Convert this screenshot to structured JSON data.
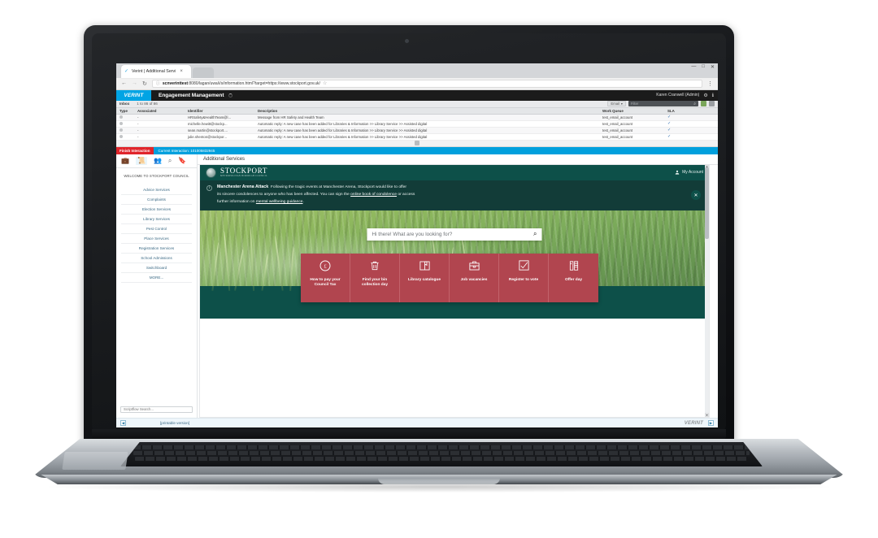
{
  "browser": {
    "tab_title": "Verint | Additional Servi",
    "tab_favicon": "verint-check-icon",
    "tab_close": "×",
    "window_minimize": "—",
    "window_maximize": "□",
    "window_close": "✕",
    "back_icon": "←",
    "forward_icon": "→",
    "reload_icon": "↻",
    "lock_icon": "ⓘ",
    "url_host": "scnverinttest",
    "url_rest": ":8080/lagan/uwa/i/s/information.html?target=https://www.stockport.gov.uk/",
    "star_icon": "☆",
    "menu_icon": "⋮"
  },
  "verint": {
    "logo": "VERINT",
    "app_title": "Engagement Management",
    "user": "Karen Cranwell (Admin)",
    "settings_icon": "⚙",
    "info_icon": "ℹ"
  },
  "inbox": {
    "label": "Inbox",
    "count": "1 to 86 of 86",
    "dropdown_value": "Email",
    "dropdown_caret": "▾",
    "filter_placeholder": "Filter",
    "search_icon": "⌕",
    "grid_icon": "grid-toggle-icon",
    "settings_icon": "gear-icon"
  },
  "grid": {
    "columns": [
      "Type",
      "Associated",
      "Identifier",
      "Description",
      "Work Queue",
      "SLA"
    ],
    "rows": [
      {
        "type": "●",
        "associated": "-",
        "identifier": "HRSafety&HealthTeam@l...",
        "description": "Message from HR Safety and Health Team",
        "work_queue": "test_email_account",
        "sla": "✓"
      },
      {
        "type": "●",
        "associated": "-",
        "identifier": "michelle.hewitt@stockp...",
        "description": "Automatic reply: A new case has been added for Libraries & Information >> Library Service >> Assisted digital",
        "work_queue": "test_email_account",
        "sla": "✓"
      },
      {
        "type": "●",
        "associated": "-",
        "identifier": "sean.martin@stockport....",
        "description": "Automatic reply: A new case has been added for Libraries & Information >> Library Service >> Assisted digital",
        "work_queue": "test_email_account",
        "sla": "✓"
      },
      {
        "type": "●",
        "associated": "-",
        "identifier": "julie.shenton@stockpor...",
        "description": "Automatic reply: A new case has been added for Libraries & Information >> Library Service >> Assisted digital",
        "work_queue": "test_email_account",
        "sla": "✓"
      }
    ]
  },
  "interaction": {
    "finish_label": "Finish Interaction",
    "current_label": "Current Interaction: 101005832945"
  },
  "toolbar": {
    "icons": [
      {
        "name": "briefcase-icon",
        "glyph": "💼",
        "selected": false
      },
      {
        "name": "document-icon",
        "glyph": "📜",
        "selected": true
      },
      {
        "name": "people-icon",
        "glyph": "👥",
        "selected": false
      },
      {
        "name": "search-icon",
        "glyph": "⌕",
        "selected": false
      },
      {
        "name": "bookmark-icon",
        "glyph": "🔖",
        "selected": false
      }
    ]
  },
  "sidebar": {
    "welcome": "WELCOME TO STOCKPORT COUNCIL",
    "items": [
      {
        "label": "Advice Services"
      },
      {
        "label": "Complaints"
      },
      {
        "label": "Election Services"
      },
      {
        "label": "Library Services"
      },
      {
        "label": "Pest Control"
      },
      {
        "label": "Place Services"
      },
      {
        "label": "Registration Services"
      },
      {
        "label": "School Admissions"
      },
      {
        "label": "Switchboard"
      },
      {
        "label": "MORE..."
      }
    ],
    "scriptflow_placeholder": "Scriptflow Search..."
  },
  "content": {
    "tab_label": "Additional Services"
  },
  "stockport": {
    "logo_line1": "STOCKPORT",
    "logo_line2": "METROPOLITAN BOROUGH COUNCIL",
    "account_label": "My Account",
    "account_icon": "person-icon",
    "alert": {
      "info_icon": "i",
      "heading": "Manchester Arena Attack",
      "text_1": "Following the tragic events at Manchester Arena, Stockport would like to offer",
      "text_2a": "its sincere condolences to anyone who has been affected. You can sign the ",
      "link_1": "online book of condolence",
      "text_2b": " or access",
      "text_3a": "further information on ",
      "link_2": "mental wellbeing guidance",
      "text_3b": ".",
      "close_icon": "✕"
    },
    "search_placeholder": "Hi there! What are you looking for?",
    "search_icon": "⌕",
    "tiles": [
      {
        "icon": "pound-coin-icon",
        "label": "How to pay your Council Tax"
      },
      {
        "icon": "bin-icon",
        "label": "Find your bin collection day"
      },
      {
        "icon": "book-icon",
        "label": "Library catalogue"
      },
      {
        "icon": "briefcase-icon",
        "label": "Job vacancies"
      },
      {
        "icon": "ballot-checkbox-icon",
        "label": "Register to vote"
      },
      {
        "icon": "building-icon",
        "label": "Offer day"
      }
    ],
    "scroll_up": "▲",
    "scroll_down": "▼"
  },
  "footer": {
    "collapse_icon": "◀",
    "printable_link": "[printable version]",
    "verint_logo": "VERINT",
    "expand_icon": "▶"
  },
  "colors": {
    "verint_blue": "#00a4e4",
    "interaction_blue": "#00a0dd",
    "finish_red": "#e0252b",
    "stockport_green": "#0d5049",
    "tile_red": "#b1454f"
  }
}
